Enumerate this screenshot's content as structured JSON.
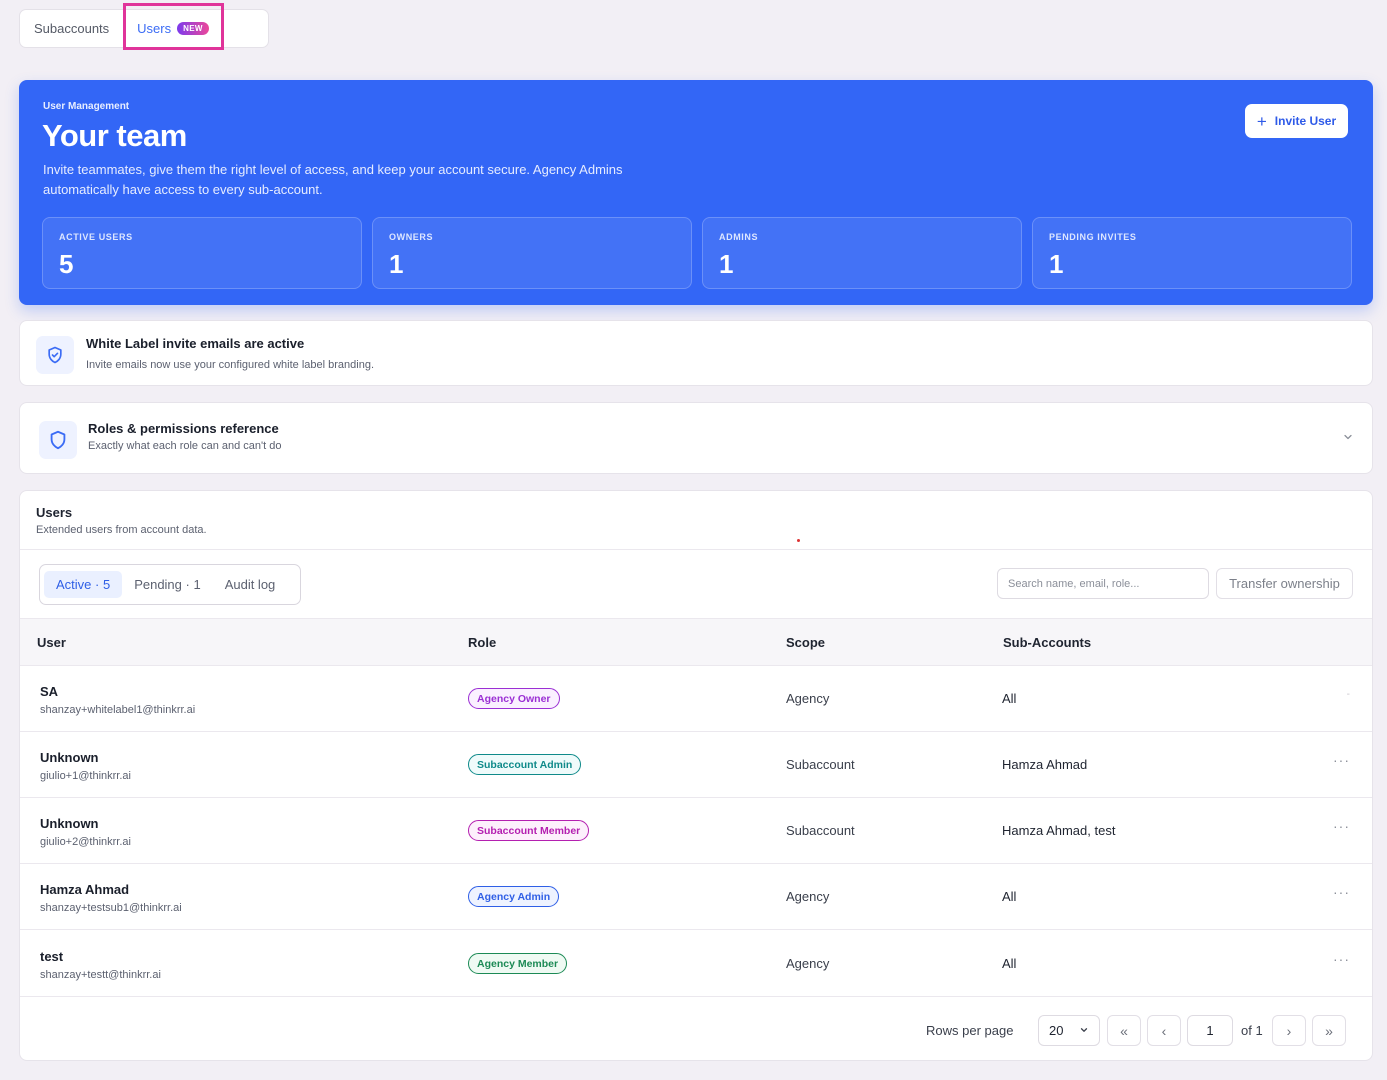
{
  "top_tabs": {
    "subaccounts_label": "Subaccounts",
    "users_label": "Users",
    "new_badge": "NEW"
  },
  "hero": {
    "eyebrow": "User Management",
    "title": "Your team",
    "description": "Invite teammates, give them the right level of access, and keep your account secure. Agency Admins automatically have access to every sub-account.",
    "invite_button": "Invite User",
    "stats": [
      {
        "label": "ACTIVE USERS",
        "value": "5"
      },
      {
        "label": "OWNERS",
        "value": "1"
      },
      {
        "label": "ADMINS",
        "value": "1"
      },
      {
        "label": "PENDING INVITES",
        "value": "1"
      }
    ]
  },
  "white_label": {
    "title": "White Label invite emails are active",
    "subtitle": "Invite emails now use your configured white label branding."
  },
  "roles": {
    "title": "Roles & permissions reference",
    "subtitle": "Exactly what each role can and can't do"
  },
  "users": {
    "title": "Users",
    "subtitle": "Extended users from account data.",
    "segments": [
      "Active · 5",
      "Pending · 1",
      "Audit log"
    ],
    "search_placeholder": "Search name, email, role...",
    "transfer_button": "Transfer ownership",
    "columns": [
      "User",
      "Role",
      "Scope",
      "Sub-Accounts"
    ],
    "rows": [
      {
        "name": "SA",
        "email": "shanzay+whitelabel1@thinkrr.ai",
        "role": "Agency Owner",
        "scope": "Agency",
        "subaccounts": "All",
        "action": "-"
      },
      {
        "name": "Unknown",
        "email": "giulio+1@thinkrr.ai",
        "role": "Subaccount Admin",
        "scope": "Subaccount",
        "subaccounts": "Hamza Ahmad",
        "action": "···"
      },
      {
        "name": "Unknown",
        "email": "giulio+2@thinkrr.ai",
        "role": "Subaccount Member",
        "scope": "Subaccount",
        "subaccounts": "Hamza Ahmad, test",
        "action": "···"
      },
      {
        "name": "Hamza Ahmad",
        "email": "shanzay+testsub1@thinkrr.ai",
        "role": "Agency Admin",
        "scope": "Agency",
        "subaccounts": "All",
        "action": "···"
      },
      {
        "name": "test",
        "email": "shanzay+testt@thinkrr.ai",
        "role": "Agency Member",
        "scope": "Agency",
        "subaccounts": "All",
        "action": "···"
      }
    ]
  },
  "pagination": {
    "rows_per_page_label": "Rows per page",
    "rows_per_page_value": "20",
    "current_page": "1",
    "of_label": "of 1",
    "first": "«",
    "prev": "‹",
    "next": "›",
    "last": "»"
  },
  "colors": {
    "hero_blue": "#3366f6",
    "highlight_pink": "#e0349a",
    "accent": "#3b6cf5"
  }
}
